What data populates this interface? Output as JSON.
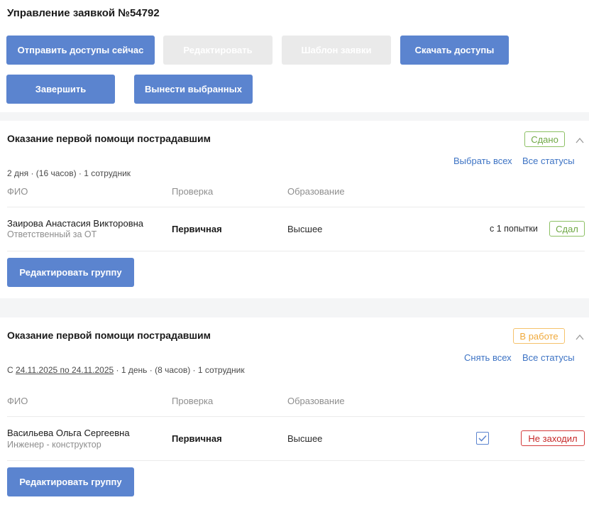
{
  "page": {
    "title": "Управление заявкой №54792"
  },
  "toolbar": {
    "send_access_now": "Отправить доступы сейчас",
    "edit": "Редактировать",
    "request_template": "Шаблон заявки",
    "download_access": "Скачать доступы",
    "finish": "Завершить",
    "remove_selected": "Вынести выбранных"
  },
  "columns": {
    "fio": "ФИО",
    "check": "Проверка",
    "education": "Образование"
  },
  "groups": [
    {
      "title": "Оказание первой помощи пострадавшим",
      "status": "Сдано",
      "select_link": "Выбрать всех",
      "statuses_link": "Все статусы",
      "meta": "2 дня · (16 часов) · 1 сотрудник",
      "row": {
        "name": "Заирова Анастасия Викторовна",
        "role": "Ответственный за ОТ",
        "check": "Первичная",
        "education": "Высшее",
        "attempts": "с 1 попытки",
        "result": "Сдал"
      },
      "edit_group": "Редактировать группу"
    },
    {
      "title": "Оказание первой помощи пострадавшим",
      "status": "В работе",
      "select_link": "Снять всех",
      "statuses_link": "Все статусы",
      "meta_prefix": "С ",
      "meta_dates": "24.11.2025 по 24.11.2025",
      "meta_suffix": " · 1 день · (8 часов) · 1 сотрудник",
      "row": {
        "name": "Васильева Ольга Сергеевна",
        "role": "Инженер - конструктор",
        "check": "Первичная",
        "education": "Высшее",
        "selected": true,
        "result": "Не заходил"
      },
      "edit_group": "Редактировать группу"
    }
  ],
  "colors": {
    "primary": "#5b84cf",
    "link": "#3d73c4",
    "success": "#6fa845",
    "warning": "#f0a93b",
    "danger": "#c62828"
  },
  "icons": {
    "collapse": "chevron-up-icon",
    "check": "check-icon"
  }
}
